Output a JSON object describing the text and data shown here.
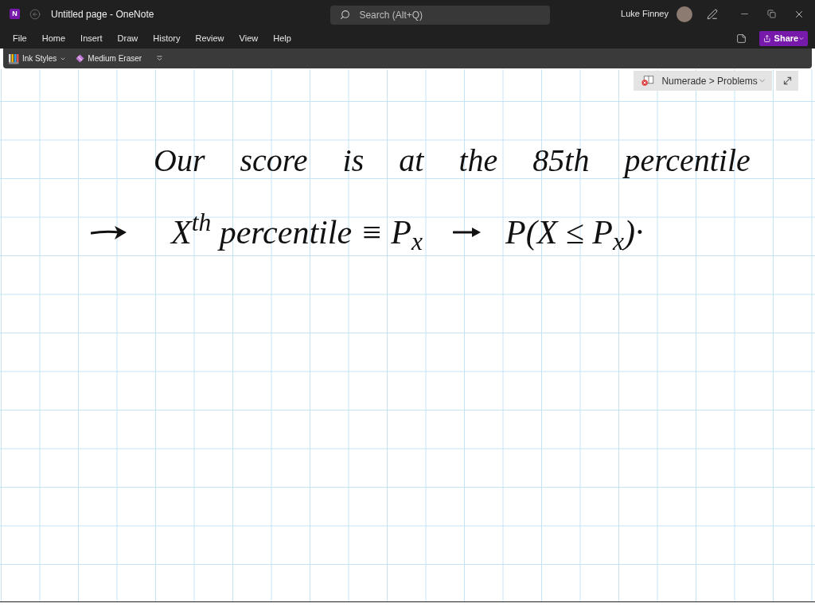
{
  "window": {
    "logo": "N",
    "title": "Untitled page - OneNote"
  },
  "search": {
    "placeholder": "Search (Alt+Q)"
  },
  "user": {
    "name": "Luke Finney"
  },
  "menu": [
    "File",
    "Home",
    "Insert",
    "Draw",
    "History",
    "Review",
    "View",
    "Help"
  ],
  "share_button": {
    "label": "Share"
  },
  "toolbar": [
    {
      "kind": "ink_styles",
      "label": "Ink Styles"
    },
    {
      "kind": "eraser",
      "label": "Medium Eraser"
    }
  ],
  "location": {
    "breadcrumb": "Numerade > Problems"
  },
  "note": {
    "heading": "Our score is at the 85th percentile",
    "line_2": [
      {
        "kind": "arrow"
      },
      {
        "kind": "text",
        "text": "X$^{th}$ percentile ≡ P$_{x}$"
      },
      {
        "kind": "arrow"
      },
      {
        "kind": "text",
        "text": "P(X ≤ P$_{x}$)·"
      }
    ]
  }
}
